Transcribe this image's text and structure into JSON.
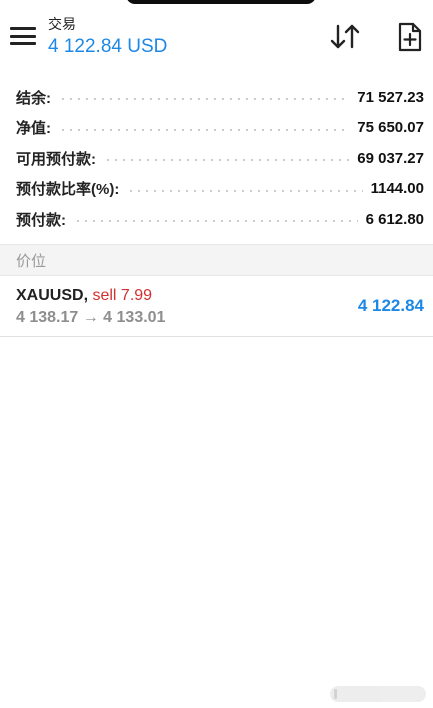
{
  "header": {
    "title": "交易",
    "balance": "4 122.84 USD"
  },
  "summary": [
    {
      "label": "结余:",
      "value": "71 527.23"
    },
    {
      "label": "净值:",
      "value": "75 650.07"
    },
    {
      "label": "可用预付款:",
      "value": "69 037.27"
    },
    {
      "label": "预付款比率(%):",
      "value": "1144.00"
    },
    {
      "label": "预付款:",
      "value": "6 612.80"
    }
  ],
  "positions_section": {
    "title": "价位"
  },
  "position": {
    "symbol": "XAUUSD,",
    "side": "sell 7.99",
    "prices": "4 138.17 → 4 133.01",
    "profit": "4 122.84"
  },
  "colors": {
    "accent": "#1e88e5",
    "sell": "#d32f2f"
  }
}
